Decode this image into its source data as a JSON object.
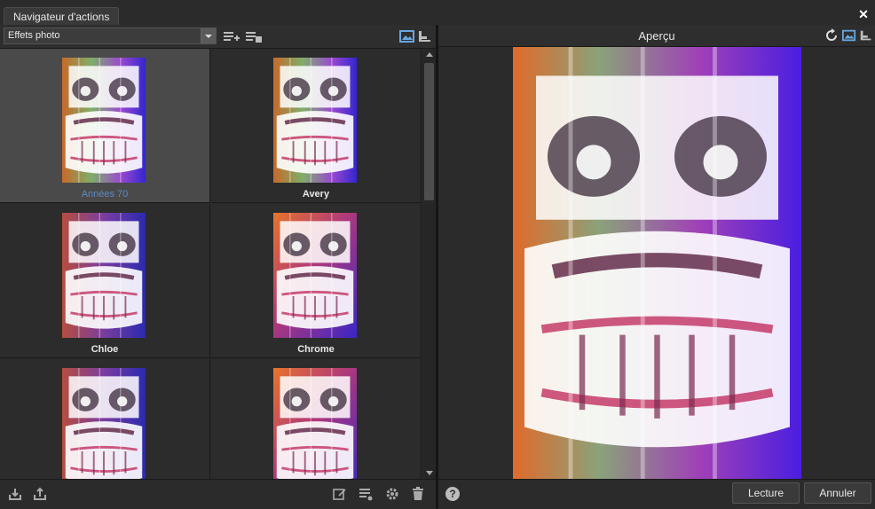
{
  "window": {
    "tab_title": "Navigateur d'actions",
    "close_glyph": "✕"
  },
  "left_panel": {
    "category_select": {
      "value": "Effets photo"
    },
    "toolbar_icons": [
      "add-to-list-icon",
      "remove-from-list-icon",
      "image-view-icon",
      "list-view-icon"
    ],
    "actions": [
      {
        "label": "Années 70",
        "selected": true
      },
      {
        "label": "Avery",
        "selected": false
      },
      {
        "label": "Chloe",
        "selected": false
      },
      {
        "label": "Chrome",
        "selected": false
      },
      {
        "label": "",
        "selected": false
      },
      {
        "label": "",
        "selected": false
      }
    ],
    "bottom_icons": [
      "import-icon",
      "share-icon",
      "edit-icon",
      "list-settings-icon",
      "gear-icon",
      "trash-icon"
    ]
  },
  "right_panel": {
    "title": "Aperçu",
    "header_icons": [
      "refresh-icon",
      "image-view-icon",
      "list-view-icon"
    ],
    "help_label": "?",
    "buttons": {
      "play": "Lecture",
      "cancel": "Annuler"
    }
  },
  "colors": {
    "selected_label": "#5c8ac6",
    "background": "#2a2a2a"
  }
}
